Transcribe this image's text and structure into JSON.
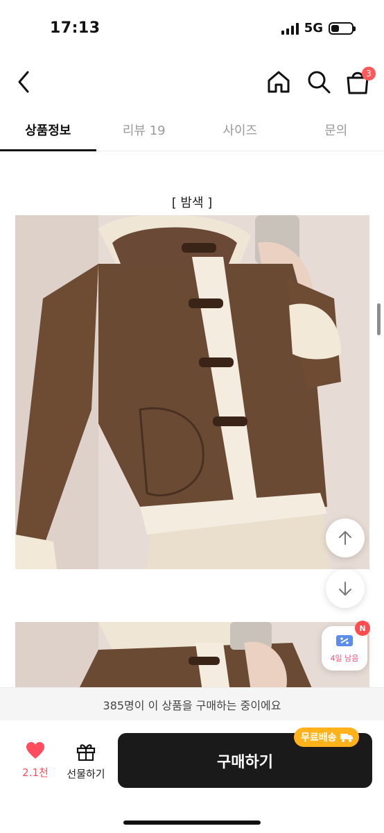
{
  "status_bar": {
    "time": "17:13",
    "network": "5G"
  },
  "header": {
    "back_icon": "chevron-left-icon",
    "home_icon": "home-icon",
    "search_icon": "search-icon",
    "cart_icon": "shopping-bag-icon",
    "cart_count": "3"
  },
  "tabs": [
    {
      "label": "상품정보",
      "active": true
    },
    {
      "label": "리뷰 19",
      "active": false
    },
    {
      "label": "사이즈",
      "active": false
    },
    {
      "label": "문의",
      "active": false
    }
  ],
  "content": {
    "color_caption": "[ 밤색 ]"
  },
  "coupon": {
    "badge": "N",
    "label": "4일 남음"
  },
  "buyers_notice": "385명이 이 상품을 구매하는 중이에요",
  "bottom_bar": {
    "like_count": "2.1천",
    "gift_label": "선물하기",
    "buy_label": "구매하기",
    "shipping_badge": "무료배송"
  },
  "colors": {
    "accent": "#ff4d5e",
    "buy_button": "#1a1a1a",
    "shipping_badge": "#ffb21a",
    "coupon_text": "#f0557a"
  }
}
